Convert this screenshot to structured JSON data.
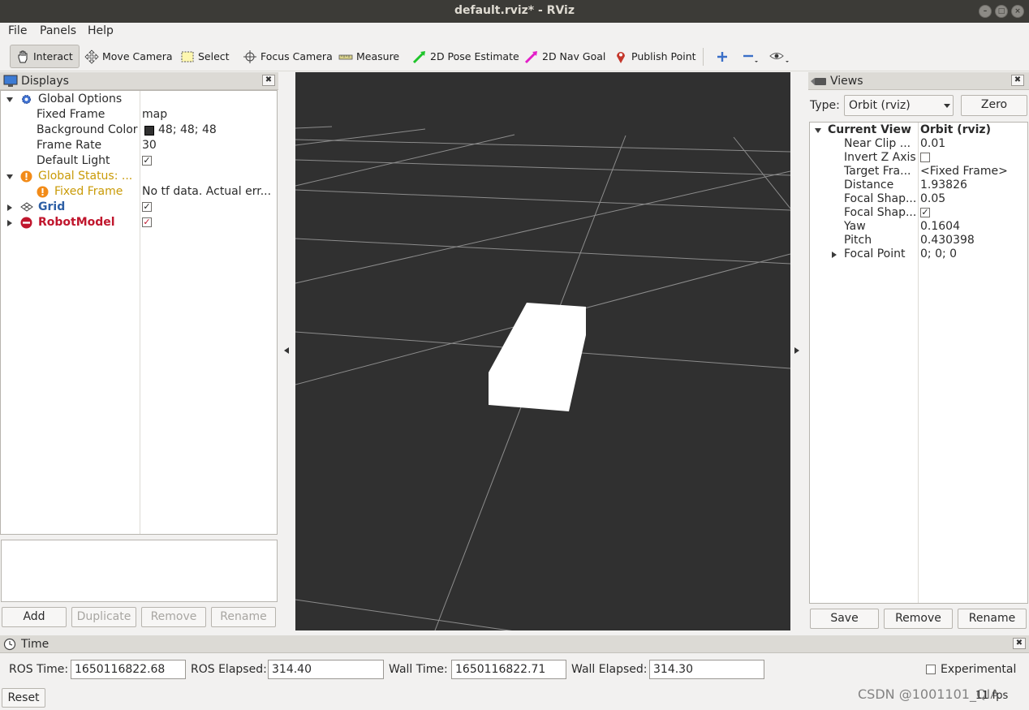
{
  "window": {
    "title": "default.rviz* - RViz"
  },
  "menu": {
    "file": "File",
    "panels": "Panels",
    "help": "Help"
  },
  "toolbar": {
    "interact": "Interact",
    "move_camera": "Move Camera",
    "select": "Select",
    "focus_camera": "Focus Camera",
    "measure": "Measure",
    "pose_estimate": "2D Pose Estimate",
    "nav_goal": "2D Nav Goal",
    "publish_point": "Publish Point"
  },
  "displays": {
    "title": "Displays",
    "global_options": "Global Options",
    "fixed_frame_label": "Fixed Frame",
    "fixed_frame_value": "map",
    "bg_color_label": "Background Color",
    "bg_color_value": "48; 48; 48",
    "frame_rate_label": "Frame Rate",
    "frame_rate_value": "30",
    "default_light_label": "Default Light",
    "global_status": "Global Status: ...",
    "status_fixed_frame": "Fixed Frame",
    "status_fixed_frame_value": "No tf data.  Actual err...",
    "grid": "Grid",
    "robot_model": "RobotModel",
    "buttons": {
      "add": "Add",
      "duplicate": "Duplicate",
      "remove": "Remove",
      "rename": "Rename"
    }
  },
  "views": {
    "title": "Views",
    "type_label": "Type:",
    "type_value": "Orbit (rviz)",
    "zero": "Zero",
    "current_view": "Current View",
    "current_view_value": "Orbit (rviz)",
    "props": [
      {
        "label": "Near Clip ...",
        "value": "0.01"
      },
      {
        "label": "Invert Z Axis",
        "value": ""
      },
      {
        "label": "Target Fra...",
        "value": "<Fixed Frame>"
      },
      {
        "label": "Distance",
        "value": "1.93826"
      },
      {
        "label": "Focal Shap...",
        "value": "0.05"
      },
      {
        "label": "Focal Shap...",
        "value": ""
      },
      {
        "label": "Yaw",
        "value": "0.1604"
      },
      {
        "label": "Pitch",
        "value": "0.430398"
      },
      {
        "label": "Focal Point",
        "value": "0; 0; 0"
      }
    ],
    "buttons": {
      "save": "Save",
      "remove": "Remove",
      "rename": "Rename"
    }
  },
  "time": {
    "title": "Time",
    "ros_time_label": "ROS Time:",
    "ros_time_value": "1650116822.68",
    "ros_elapsed_label": "ROS Elapsed:",
    "ros_elapsed_value": "314.40",
    "wall_time_label": "Wall Time:",
    "wall_time_value": "1650116822.71",
    "wall_elapsed_label": "Wall Elapsed:",
    "wall_elapsed_value": "314.30",
    "experimental": "Experimental",
    "reset": "Reset",
    "fps": "11 fps"
  },
  "watermark": "CSDN @1001101_QIA",
  "colors": {
    "viewport_bg": "#303030",
    "warning": "#c99a06",
    "grid_blue": "#2d5fa5",
    "error_red": "#c0162d",
    "window_bg": "#f2f1f0"
  }
}
